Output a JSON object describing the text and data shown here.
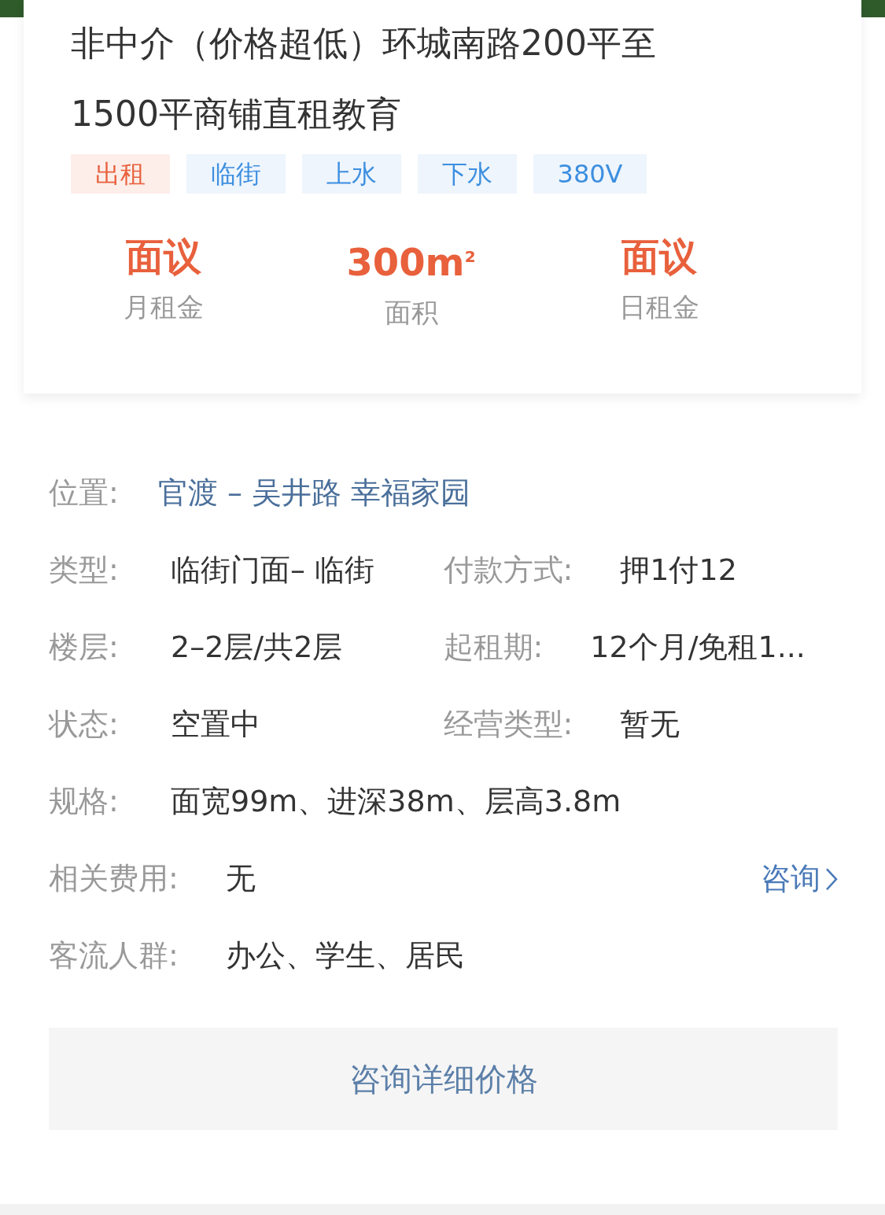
{
  "listing": {
    "title": "非中介（价格超低）环城南路200平至1500平商铺直租教育",
    "tags": [
      {
        "label": "出租",
        "kind": "deal"
      },
      {
        "label": "临街",
        "kind": "feature"
      },
      {
        "label": "上水",
        "kind": "feature"
      },
      {
        "label": "下水",
        "kind": "feature"
      },
      {
        "label": "380V",
        "kind": "feature"
      }
    ],
    "stats": [
      {
        "value": "面议",
        "label": "月租金"
      },
      {
        "value": "300m$^{2}$",
        "label": "面积"
      },
      {
        "value": "面议",
        "label": "日租金"
      }
    ]
  },
  "details": [
    {
      "kind": "location",
      "fields": [
        {
          "label": "位置:",
          "value": "官渡 – 吴井路 幸福家园"
        }
      ]
    },
    {
      "kind": "pair",
      "fields": [
        {
          "label": "类型:",
          "value": "临街门面– 临街"
        },
        {
          "label": "付款方式:",
          "value": "押1付12"
        }
      ]
    },
    {
      "kind": "pair",
      "fields": [
        {
          "label": "楼层:",
          "value": "2–2层/共2层"
        },
        {
          "label": "起租期:",
          "value": "12个月/免租1..."
        }
      ]
    },
    {
      "kind": "pair",
      "fields": [
        {
          "label": "状态:",
          "value": "空置中"
        },
        {
          "label": "经营类型:",
          "value": "暂无"
        }
      ]
    },
    {
      "kind": "pair",
      "fields": [
        {
          "label": "规格:",
          "value": "面宽99m、进深38m、层高3.8m"
        }
      ]
    },
    {
      "kind": "pair",
      "fields": [
        {
          "label": "相关费用:",
          "value": "无"
        }
      ],
      "action": "咨询"
    },
    {
      "kind": "pair",
      "fields": [
        {
          "label": "客流人群:",
          "value": "办公、学生、居民"
        }
      ]
    }
  ],
  "consult_button": "咨询详细价格"
}
